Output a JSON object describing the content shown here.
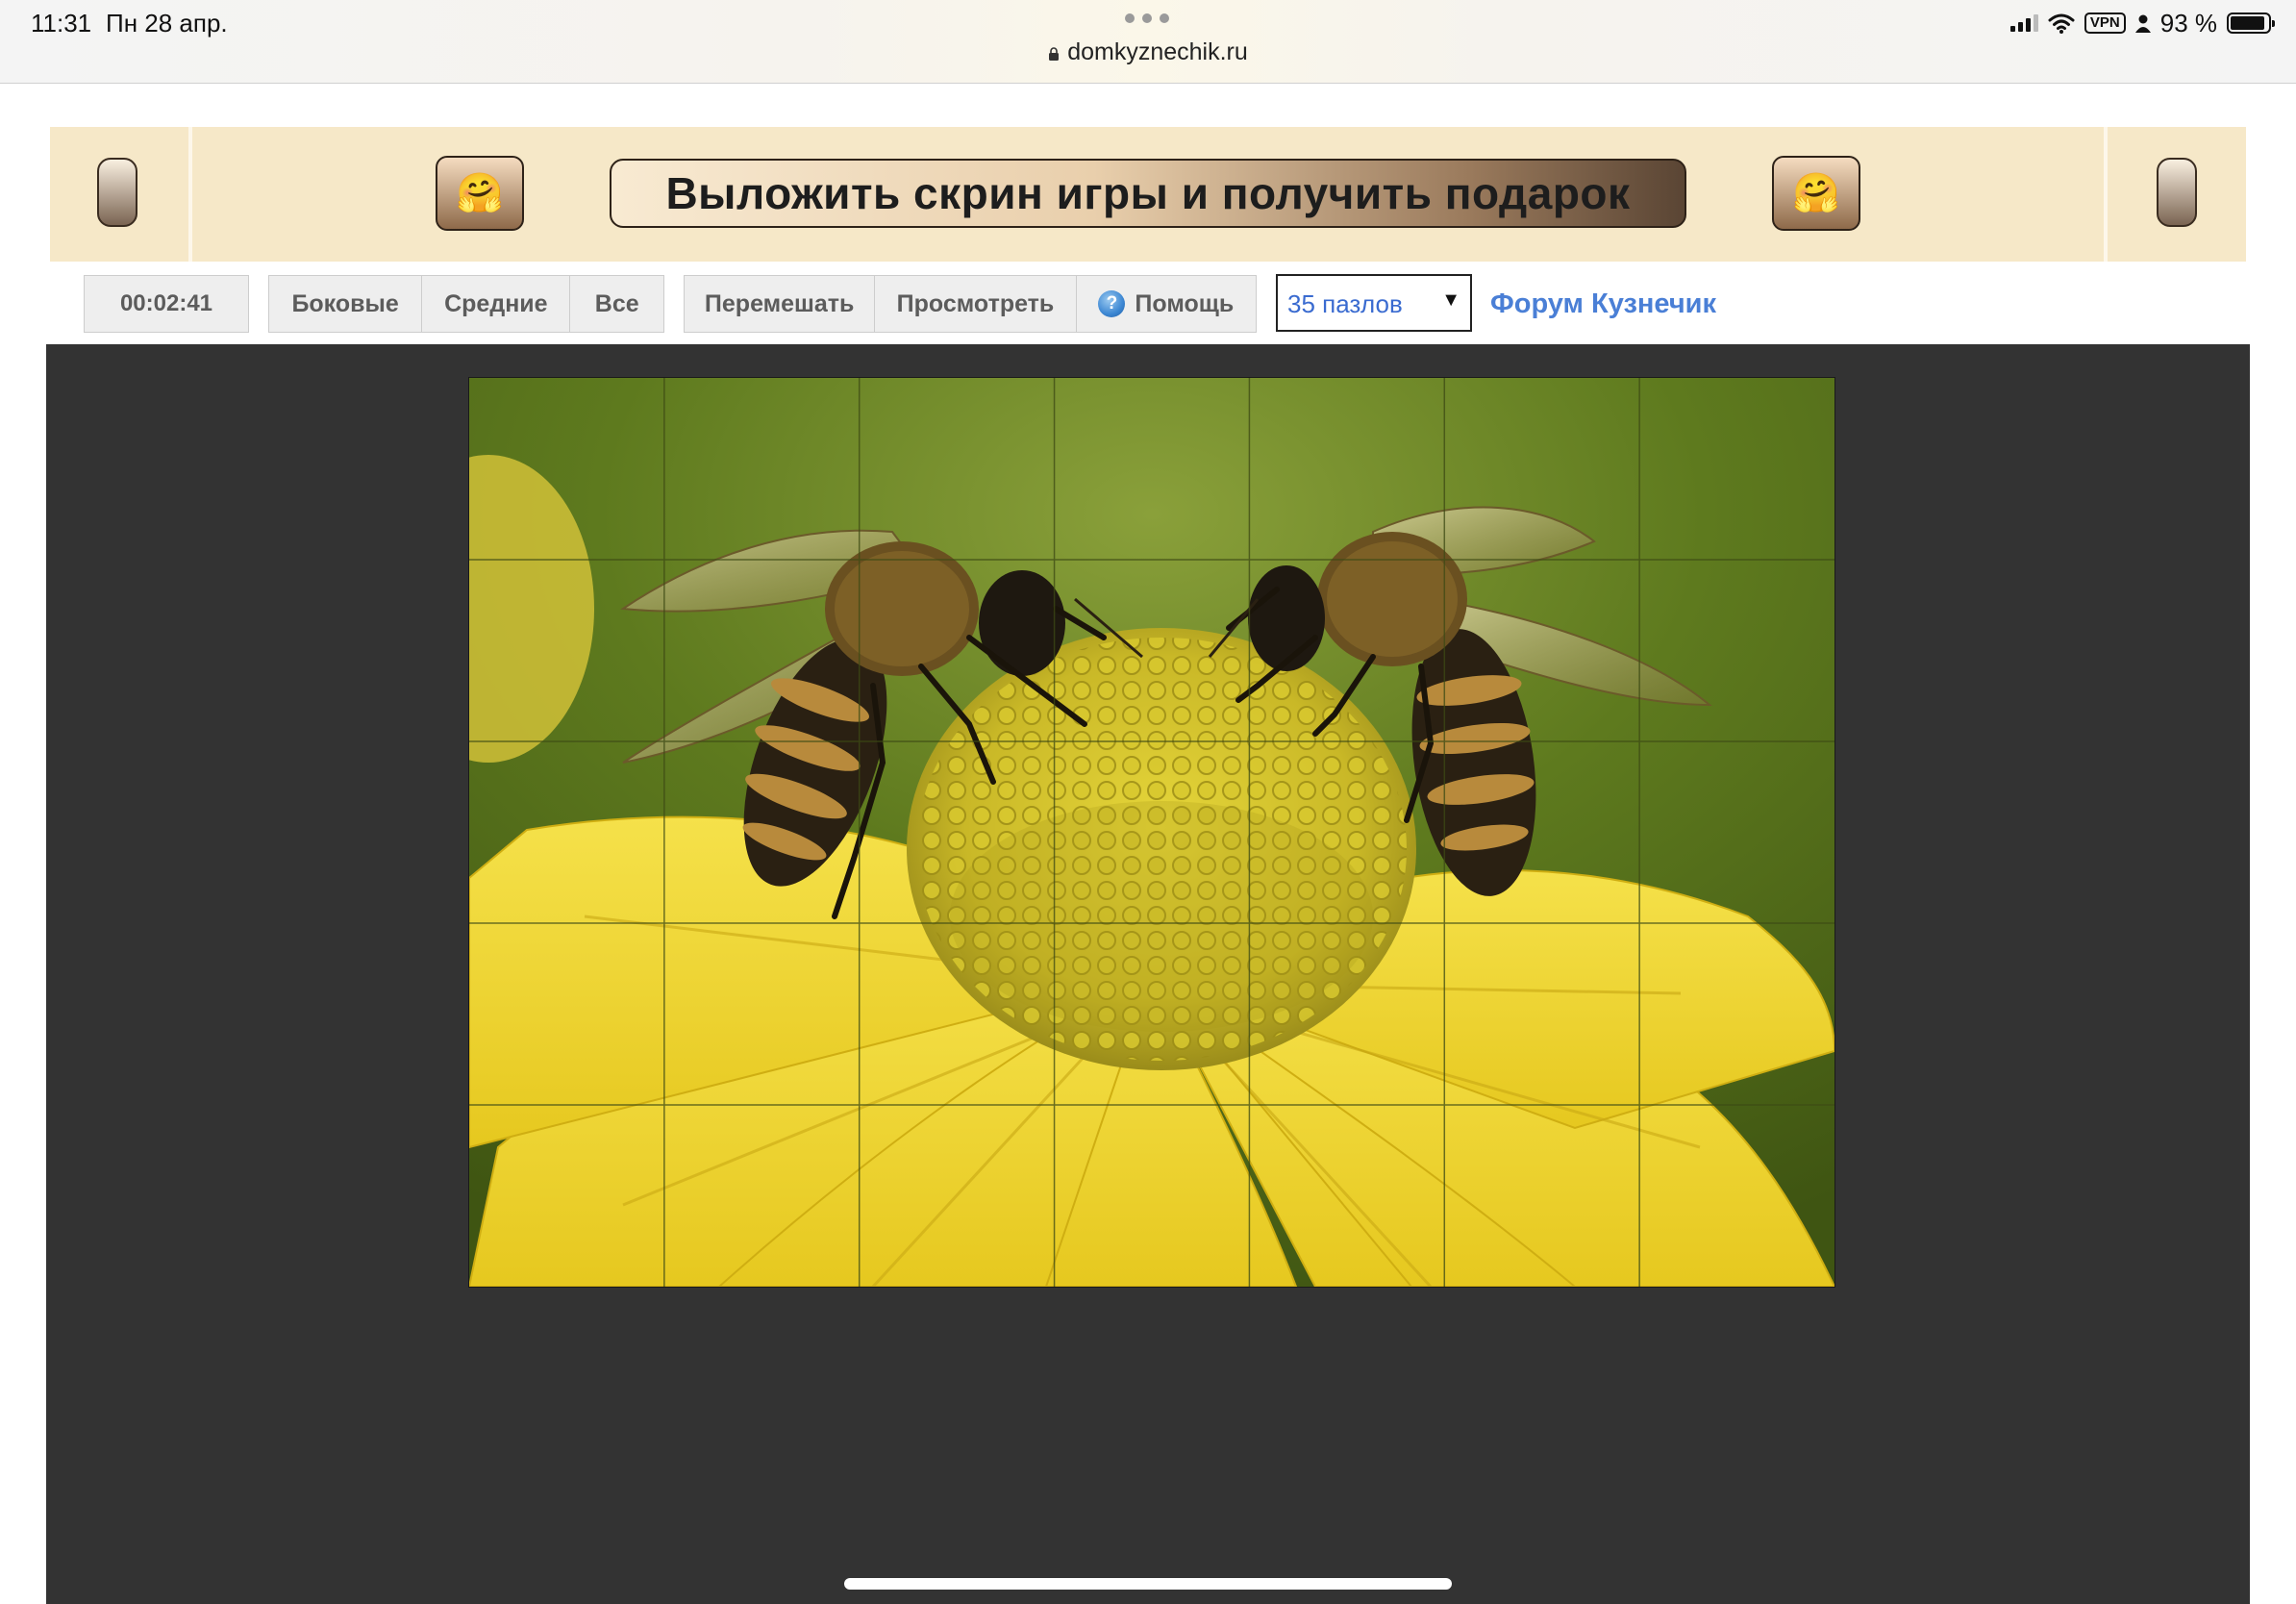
{
  "status_bar": {
    "time": "11:31",
    "date": "Пн 28 апр.",
    "url": "domkyznechik.ru",
    "vpn": "VPN",
    "battery": "93 %",
    "battery_level": 0.93
  },
  "banner": {
    "promo_label": "Выложить скрин игры и получить подарок",
    "left_emoji": "🤗",
    "right_emoji": "🤗"
  },
  "toolbar": {
    "timer": "00:02:41",
    "filters": [
      "Боковые",
      "Средние",
      "Все"
    ],
    "actions": {
      "shuffle": "Перемешать",
      "preview": "Просмотреть",
      "help": "Помощь"
    },
    "piece_count": "35 пазлов",
    "forum_link": "Форум Кузнечик"
  },
  "puzzle": {
    "columns": 7,
    "rows": 5
  },
  "colors": {
    "game_background": "#333333",
    "banner_background": "#f6e8c8",
    "link": "#4a7fd6"
  }
}
